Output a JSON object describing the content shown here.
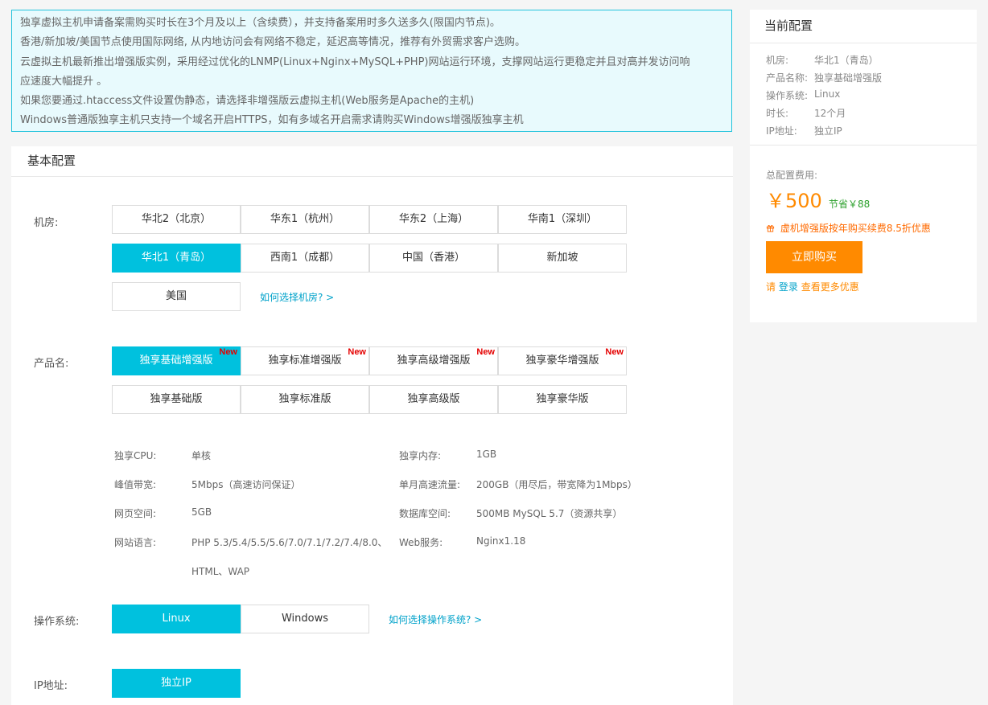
{
  "notice": {
    "lines": [
      "独享虚拟主机申请备案需购买时长在3个月及以上（含续费），并支持备案用时多久送多久(限国内节点)。",
      "香港/新加坡/美国节点使用国际网络, 从内地访问会有网络不稳定，延迟高等情况，推荐有外贸需求客户选购。",
      "云虚拟主机最新推出增强版实例，采用经过优化的LNMP(Linux+Nginx+MySQL+PHP)网站运行环境，支撑网站运行更稳定并且对高并发访问响",
      "应速度大幅提升 。",
      "如果您要通过.htaccess文件设置伪静态，请选择非增强版云虚拟主机(Web服务是Apache的主机)",
      "Windows普通版独享主机只支持一个域名开启HTTPS，如有多域名开启需求请购买Windows增强版独享主机"
    ]
  },
  "basic": {
    "title": "基本配置",
    "region_label": "机房:",
    "regions": [
      "华北2（北京）",
      "华东1（杭州）",
      "华东2（上海）",
      "华南1（深圳）",
      "华北1（青岛）",
      "西南1（成都）",
      "中国（香港）",
      "新加坡",
      "美国"
    ],
    "region_help": "如何选择机房? >",
    "product_label": "产品名:",
    "products": [
      "独享基础增强版",
      "独享标准增强版",
      "独享高级增强版",
      "独享豪华增强版",
      "独享基础版",
      "独享标准版",
      "独享高级版",
      "独享豪华版"
    ],
    "new_badge": "New",
    "specs": {
      "cpu_label": "独享CPU:",
      "cpu": "单核",
      "mem_label": "独享内存:",
      "mem": "1GB",
      "bw_label": "峰值带宽:",
      "bw": "5Mbps（高速访问保证）",
      "traffic_label": "单月高速流量:",
      "traffic": "200GB（用尽后，带宽降为1Mbps）",
      "web_label": "网页空间:",
      "web": "5GB",
      "db_label": "数据库空间:",
      "db": "500MB MySQL 5.7（资源共享）",
      "lang_label": "网站语言:",
      "lang1": "PHP 5.3/5.4/5.5/5.6/7.0/7.1/7.2/7.4/8.0、",
      "lang2": "HTML、WAP",
      "server_label": "Web服务:",
      "server": "Nginx1.18"
    },
    "os_label": "操作系统:",
    "os": [
      "Linux",
      "Windows"
    ],
    "os_help": "如何选择操作系统? >",
    "ip_label": "IP地址:",
    "ip": "独立IP"
  },
  "side": {
    "title": "当前配置",
    "rows": [
      {
        "k": "机房:",
        "v": "华北1（青岛）"
      },
      {
        "k": "产品名称:",
        "v": "独享基础增强版"
      },
      {
        "k": "操作系统:",
        "v": "Linux"
      },
      {
        "k": "时长:",
        "v": "12个月"
      },
      {
        "k": "IP地址:",
        "v": "独立IP"
      }
    ],
    "total_label": "总配置费用:",
    "price": "￥500",
    "save": "节省￥88",
    "promo": "虚机增强版按年购买续费8.5折优惠",
    "buy": "立即购买",
    "login_prefix": "请",
    "login": "登录",
    "login_suffix": "查看更多优惠"
  },
  "colors": {
    "accent": "#00c1de",
    "buy": "#ff8a00",
    "price": "#ff8a00",
    "save": "#2ca02c",
    "new": "#e40000"
  }
}
